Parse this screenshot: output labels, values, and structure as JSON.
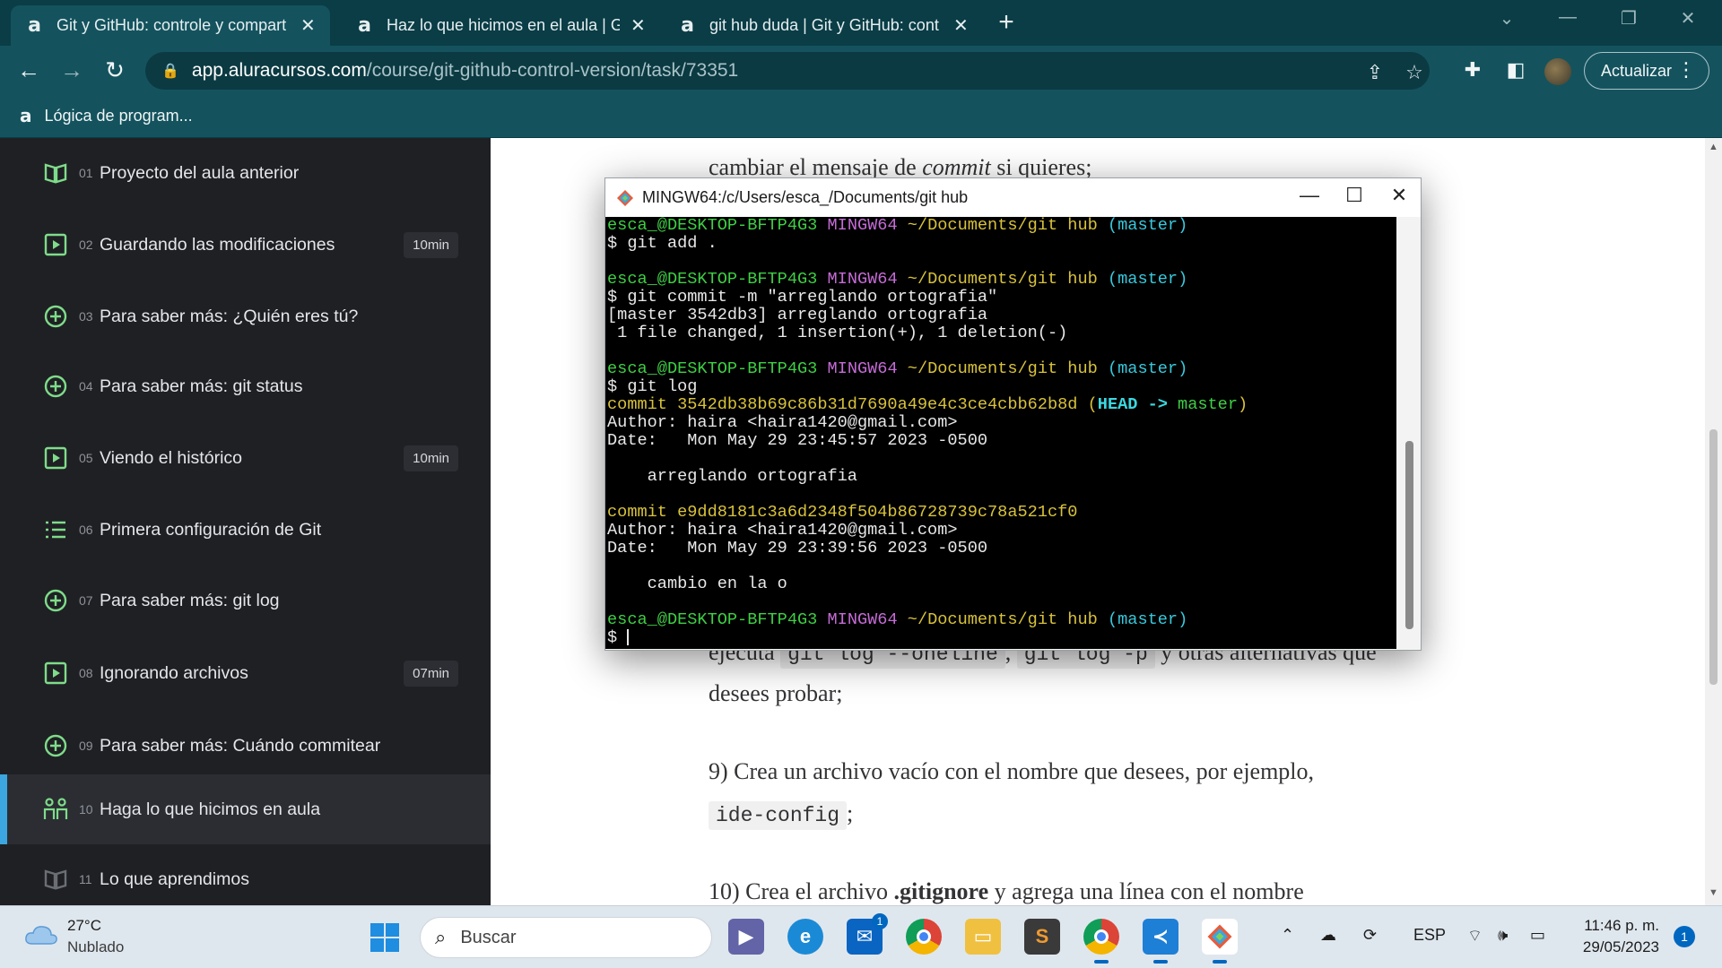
{
  "browser": {
    "tabs": [
      {
        "title": "Git y GitHub: controle y compart",
        "favicon": "a"
      },
      {
        "title": "Haz lo que hicimos en el aula | Gi",
        "favicon": "a"
      },
      {
        "title": "git hub duda | Git y GitHub: cont",
        "favicon": "a"
      }
    ],
    "url_host": "app.aluracursos.com",
    "url_path": "/course/git-github-control-version/task/73351",
    "update_label": "Actualizar",
    "bookmark_label": "Lógica de program...",
    "bookmark_favicon": "a"
  },
  "sidebar": {
    "items": [
      {
        "num": "01",
        "title": "Proyecto del aula anterior",
        "icon": "book-icon",
        "duration": ""
      },
      {
        "num": "02",
        "title": "Guardando las modificaciones",
        "icon": "video-icon",
        "duration": "10min"
      },
      {
        "num": "03",
        "title": "Para saber más: ¿Quién eres tú?",
        "icon": "plus-circle-icon",
        "duration": ""
      },
      {
        "num": "04",
        "title": "Para saber más: git status",
        "icon": "plus-circle-icon",
        "duration": ""
      },
      {
        "num": "05",
        "title": "Viendo el histórico",
        "icon": "video-icon",
        "duration": "10min"
      },
      {
        "num": "06",
        "title": "Primera configuración de Git",
        "icon": "list-icon",
        "duration": ""
      },
      {
        "num": "07",
        "title": "Para saber más: git log",
        "icon": "plus-circle-icon",
        "duration": ""
      },
      {
        "num": "08",
        "title": "Ignorando archivos",
        "icon": "video-icon",
        "duration": "07min"
      },
      {
        "num": "09",
        "title": "Para saber más: Cuándo commitear",
        "icon": "plus-circle-icon",
        "duration": ""
      },
      {
        "num": "10",
        "title": "Haga lo que hicimos en aula",
        "icon": "people-icon",
        "duration": ""
      },
      {
        "num": "11",
        "title": "Lo que aprendimos",
        "icon": "book-icon",
        "duration": ""
      }
    ]
  },
  "content": {
    "line1_pre": "cambiar el mensaje de ",
    "line1_em": "commit",
    "line1_post": " si quieres;",
    "line2_pre": "ejecuta ",
    "line2_code1": "git log --oneline",
    "line2_mid": ", ",
    "line2_code2": "git log -p",
    "line2_post": " y otras alternativas que",
    "line3": "desees probar;",
    "line4": "9) Crea un archivo vacío con el nombre que desees, por ejemplo,",
    "line5_code": "ide-config",
    "line5_post": ";",
    "line6_pre": "10) Crea el archivo ",
    "line6_bold": ".gitignore",
    "line6_post": " y agrega una línea con el nombre"
  },
  "terminal": {
    "title": "MINGW64:/c/Users/esca_/Documents/git hub",
    "prompt_user": "esca_@DESKTOP-BFTP4G3",
    "prompt_env": "MINGW64",
    "prompt_path": "~/Documents/git hub",
    "prompt_branch": "(master)",
    "cmd1": "$ git add .",
    "cmd2": "$ git commit -m \"arreglando ortografia\"",
    "out2a": "[master 3542db3] arreglando ortografia",
    "out2b": " 1 file changed, 1 insertion(+), 1 deletion(-)",
    "cmd3": "$ git log",
    "commit1_hash": "commit 3542db38b69c86b31d7690a49e4c3ce4cbb62b8d",
    "commit1_head_open": "(",
    "commit1_head": "HEAD -> ",
    "commit1_branch": "master",
    "commit1_head_close": ")",
    "commit1_author": "Author: haira <haira1420@gmail.com>",
    "commit1_date": "Date:   Mon May 29 23:45:57 2023 -0500",
    "commit1_msg": "    arreglando ortografia",
    "commit2_hash": "commit e9dd8181c3a6d2348f504b86728739c78a521cf0",
    "commit2_author": "Author: haira <haira1420@gmail.com>",
    "commit2_date": "Date:   Mon May 29 23:39:56 2023 -0500",
    "commit2_msg": "    cambio en la o",
    "final_prompt": "$ "
  },
  "taskbar": {
    "weather_temp": "27°C",
    "weather_desc": "Nublado",
    "search_placeholder": "Buscar",
    "language": "ESP",
    "time": "11:46 p. m.",
    "date": "29/05/2023",
    "mail_badge": "1",
    "notification_count": "1"
  },
  "colors": {
    "tabstrip": "#0a3d46",
    "toolbar": "#14535e",
    "sidebar": "#1f2024",
    "sidebar_accent": "#3ba6df",
    "lesson_icon": "#7fdc8a",
    "terminal_green": "#3fcf45",
    "terminal_purple": "#c56bd6",
    "terminal_yellow": "#d8c23a",
    "terminal_cyan": "#38c9dc"
  }
}
